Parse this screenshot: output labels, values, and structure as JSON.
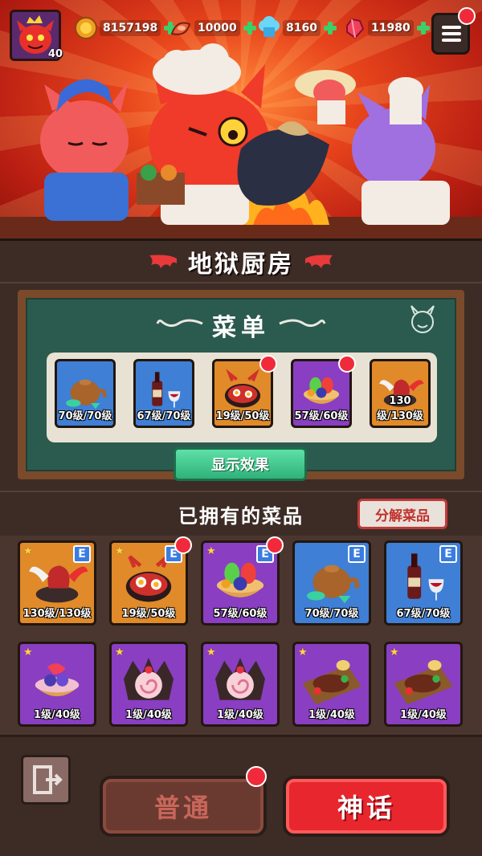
{
  "player": {
    "level": "40"
  },
  "resources": [
    {
      "icon": "gold-coin-icon",
      "value": "8157198"
    },
    {
      "icon": "meat-icon",
      "value": "10000"
    },
    {
      "icon": "chef-hat-icon",
      "value": "8160"
    },
    {
      "icon": "red-crystal-icon",
      "value": "11980"
    }
  ],
  "title": "地狱厨房",
  "menu_board": {
    "title": "菜单",
    "dishes": [
      {
        "icon": "teapot-dish-icon",
        "level": "70级/70级",
        "rarity": "blue",
        "badge": false
      },
      {
        "icon": "wine-dish-icon",
        "level": "67级/70级",
        "rarity": "blue",
        "badge": false
      },
      {
        "icon": "devil-pan-dish-icon",
        "level": "19级/50级",
        "rarity": "orange",
        "badge": true
      },
      {
        "icon": "fruit-tart-dish-icon",
        "level": "57级/60级",
        "rarity": "purple",
        "badge": true
      },
      {
        "icon": "winged-dragon-dish-icon",
        "level": "130级/130级",
        "rarity": "orange",
        "badge": false
      }
    ],
    "show_effect_label": "显示效果"
  },
  "owned": {
    "title": "已拥有的菜品",
    "decompose_label": "分解菜品",
    "equip_letter": "E",
    "items": [
      {
        "icon": "winged-dragon-dish-icon",
        "level": "130级/130级",
        "rarity": "orange",
        "equipped": true,
        "badge": false
      },
      {
        "icon": "devil-pan-dish-icon",
        "level": "19级/50级",
        "rarity": "orange",
        "equipped": true,
        "badge": true
      },
      {
        "icon": "fruit-tart-dish-icon",
        "level": "57级/60级",
        "rarity": "purple",
        "equipped": true,
        "badge": true
      },
      {
        "icon": "teapot-dish-icon",
        "level": "70级/70级",
        "rarity": "blue",
        "equipped": true,
        "badge": false
      },
      {
        "icon": "wine-dish-icon",
        "level": "67级/70级",
        "rarity": "blue",
        "equipped": true,
        "badge": false
      },
      {
        "icon": "berry-tart-dish-icon",
        "level": "1级/40级",
        "rarity": "purple",
        "equipped": false,
        "badge": false
      },
      {
        "icon": "swiss-roll-dish-icon",
        "level": "1级/40级",
        "rarity": "purple",
        "equipped": false,
        "badge": false
      },
      {
        "icon": "swiss-roll-dish-icon",
        "level": "1级/40级",
        "rarity": "purple",
        "equipped": false,
        "badge": false
      },
      {
        "icon": "steak-board-dish-icon",
        "level": "1级/40级",
        "rarity": "purple",
        "equipped": false,
        "badge": false
      },
      {
        "icon": "steak-board-dish-icon",
        "level": "1级/40级",
        "rarity": "purple",
        "equipped": false,
        "badge": false
      }
    ]
  },
  "tabs": {
    "normal_label": "普通",
    "myth_label": "神话"
  },
  "colors": {
    "blue": "#3f7fd6",
    "orange": "#e08a2a",
    "purple": "#8a3ec2",
    "notify": "#f02a3a",
    "board": "#2b5a4e"
  }
}
